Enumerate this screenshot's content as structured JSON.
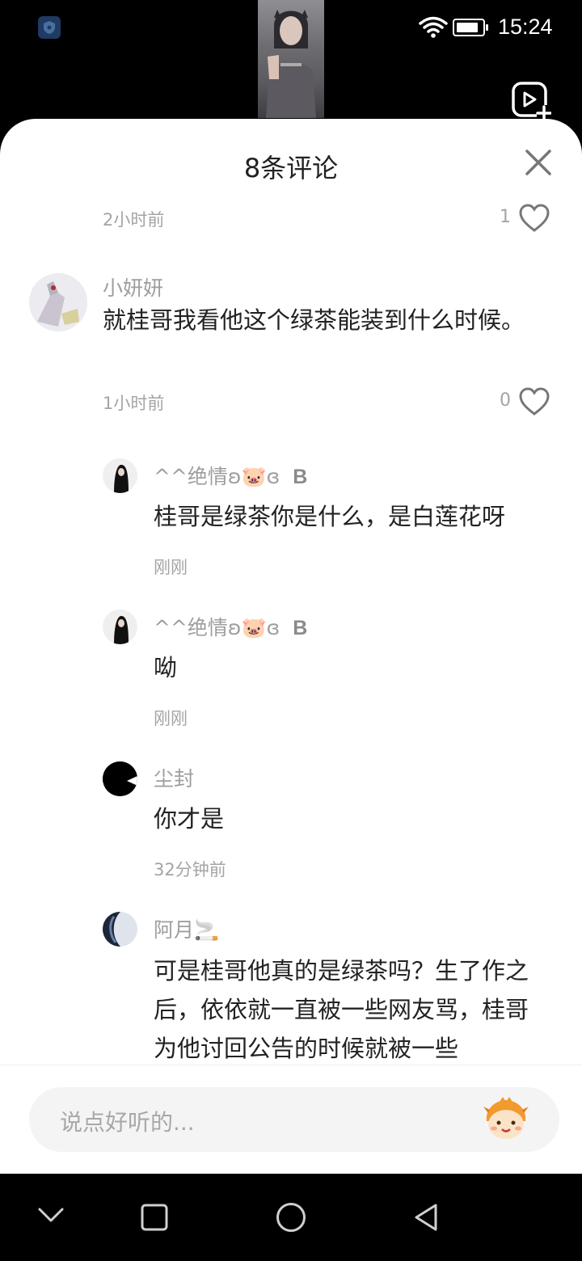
{
  "status_bar": {
    "time": "15:24",
    "battery_level": 0.85
  },
  "sheet": {
    "title": "8条评论",
    "close_icon": "close-icon"
  },
  "partial_comment": {
    "time": "2小时前",
    "likes": "1"
  },
  "comment": {
    "author": "小妍妍",
    "text": "就桂哥我看他这个绿茶能装到什么时候。",
    "time": "1小时前",
    "likes": "0"
  },
  "replies": [
    {
      "author": "^^绝情ʚ🐷ɞ",
      "badge": "B",
      "text": "桂哥是绿茶你是什么，是白莲花呀",
      "time": "刚刚"
    },
    {
      "author": "^^绝情ʚ🐷ɞ",
      "badge": "B",
      "text": "呦",
      "time": "刚刚"
    },
    {
      "author": "尘封",
      "badge": "",
      "text": "你才是",
      "time": "32分钟前"
    },
    {
      "author": "阿月🚬",
      "badge": "",
      "text": "可是桂哥他真的是绿茶吗？生了作之后，依依就一直被一些网友骂，桂哥为他讨回公告的时候就被一些",
      "time": ""
    }
  ],
  "input": {
    "placeholder": "说点好听的..."
  },
  "colors": {
    "sheet_bg": "#ffffff",
    "text_primary": "#222222",
    "text_secondary": "#9e9e9e",
    "input_bg": "#f4f4f4"
  }
}
